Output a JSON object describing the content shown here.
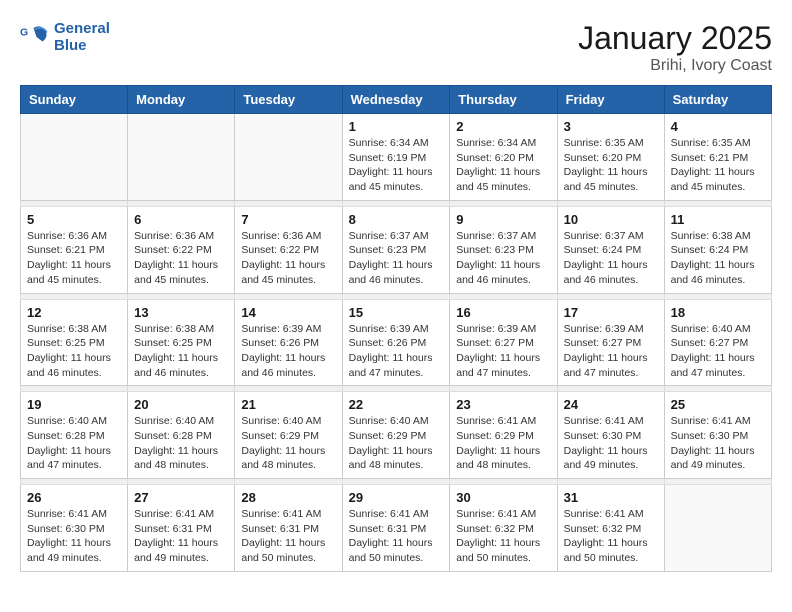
{
  "logo": {
    "text_general": "General",
    "text_blue": "Blue"
  },
  "header": {
    "title": "January 2025",
    "subtitle": "Brihi, Ivory Coast"
  },
  "days_of_week": [
    "Sunday",
    "Monday",
    "Tuesday",
    "Wednesday",
    "Thursday",
    "Friday",
    "Saturday"
  ],
  "weeks": [
    {
      "days": [
        {
          "num": "",
          "info": ""
        },
        {
          "num": "",
          "info": ""
        },
        {
          "num": "",
          "info": ""
        },
        {
          "num": "1",
          "info": "Sunrise: 6:34 AM\nSunset: 6:19 PM\nDaylight: 11 hours\nand 45 minutes."
        },
        {
          "num": "2",
          "info": "Sunrise: 6:34 AM\nSunset: 6:20 PM\nDaylight: 11 hours\nand 45 minutes."
        },
        {
          "num": "3",
          "info": "Sunrise: 6:35 AM\nSunset: 6:20 PM\nDaylight: 11 hours\nand 45 minutes."
        },
        {
          "num": "4",
          "info": "Sunrise: 6:35 AM\nSunset: 6:21 PM\nDaylight: 11 hours\nand 45 minutes."
        }
      ]
    },
    {
      "days": [
        {
          "num": "5",
          "info": "Sunrise: 6:36 AM\nSunset: 6:21 PM\nDaylight: 11 hours\nand 45 minutes."
        },
        {
          "num": "6",
          "info": "Sunrise: 6:36 AM\nSunset: 6:22 PM\nDaylight: 11 hours\nand 45 minutes."
        },
        {
          "num": "7",
          "info": "Sunrise: 6:36 AM\nSunset: 6:22 PM\nDaylight: 11 hours\nand 45 minutes."
        },
        {
          "num": "8",
          "info": "Sunrise: 6:37 AM\nSunset: 6:23 PM\nDaylight: 11 hours\nand 46 minutes."
        },
        {
          "num": "9",
          "info": "Sunrise: 6:37 AM\nSunset: 6:23 PM\nDaylight: 11 hours\nand 46 minutes."
        },
        {
          "num": "10",
          "info": "Sunrise: 6:37 AM\nSunset: 6:24 PM\nDaylight: 11 hours\nand 46 minutes."
        },
        {
          "num": "11",
          "info": "Sunrise: 6:38 AM\nSunset: 6:24 PM\nDaylight: 11 hours\nand 46 minutes."
        }
      ]
    },
    {
      "days": [
        {
          "num": "12",
          "info": "Sunrise: 6:38 AM\nSunset: 6:25 PM\nDaylight: 11 hours\nand 46 minutes."
        },
        {
          "num": "13",
          "info": "Sunrise: 6:38 AM\nSunset: 6:25 PM\nDaylight: 11 hours\nand 46 minutes."
        },
        {
          "num": "14",
          "info": "Sunrise: 6:39 AM\nSunset: 6:26 PM\nDaylight: 11 hours\nand 46 minutes."
        },
        {
          "num": "15",
          "info": "Sunrise: 6:39 AM\nSunset: 6:26 PM\nDaylight: 11 hours\nand 47 minutes."
        },
        {
          "num": "16",
          "info": "Sunrise: 6:39 AM\nSunset: 6:27 PM\nDaylight: 11 hours\nand 47 minutes."
        },
        {
          "num": "17",
          "info": "Sunrise: 6:39 AM\nSunset: 6:27 PM\nDaylight: 11 hours\nand 47 minutes."
        },
        {
          "num": "18",
          "info": "Sunrise: 6:40 AM\nSunset: 6:27 PM\nDaylight: 11 hours\nand 47 minutes."
        }
      ]
    },
    {
      "days": [
        {
          "num": "19",
          "info": "Sunrise: 6:40 AM\nSunset: 6:28 PM\nDaylight: 11 hours\nand 47 minutes."
        },
        {
          "num": "20",
          "info": "Sunrise: 6:40 AM\nSunset: 6:28 PM\nDaylight: 11 hours\nand 48 minutes."
        },
        {
          "num": "21",
          "info": "Sunrise: 6:40 AM\nSunset: 6:29 PM\nDaylight: 11 hours\nand 48 minutes."
        },
        {
          "num": "22",
          "info": "Sunrise: 6:40 AM\nSunset: 6:29 PM\nDaylight: 11 hours\nand 48 minutes."
        },
        {
          "num": "23",
          "info": "Sunrise: 6:41 AM\nSunset: 6:29 PM\nDaylight: 11 hours\nand 48 minutes."
        },
        {
          "num": "24",
          "info": "Sunrise: 6:41 AM\nSunset: 6:30 PM\nDaylight: 11 hours\nand 49 minutes."
        },
        {
          "num": "25",
          "info": "Sunrise: 6:41 AM\nSunset: 6:30 PM\nDaylight: 11 hours\nand 49 minutes."
        }
      ]
    },
    {
      "days": [
        {
          "num": "26",
          "info": "Sunrise: 6:41 AM\nSunset: 6:30 PM\nDaylight: 11 hours\nand 49 minutes."
        },
        {
          "num": "27",
          "info": "Sunrise: 6:41 AM\nSunset: 6:31 PM\nDaylight: 11 hours\nand 49 minutes."
        },
        {
          "num": "28",
          "info": "Sunrise: 6:41 AM\nSunset: 6:31 PM\nDaylight: 11 hours\nand 50 minutes."
        },
        {
          "num": "29",
          "info": "Sunrise: 6:41 AM\nSunset: 6:31 PM\nDaylight: 11 hours\nand 50 minutes."
        },
        {
          "num": "30",
          "info": "Sunrise: 6:41 AM\nSunset: 6:32 PM\nDaylight: 11 hours\nand 50 minutes."
        },
        {
          "num": "31",
          "info": "Sunrise: 6:41 AM\nSunset: 6:32 PM\nDaylight: 11 hours\nand 50 minutes."
        },
        {
          "num": "",
          "info": ""
        }
      ]
    }
  ]
}
